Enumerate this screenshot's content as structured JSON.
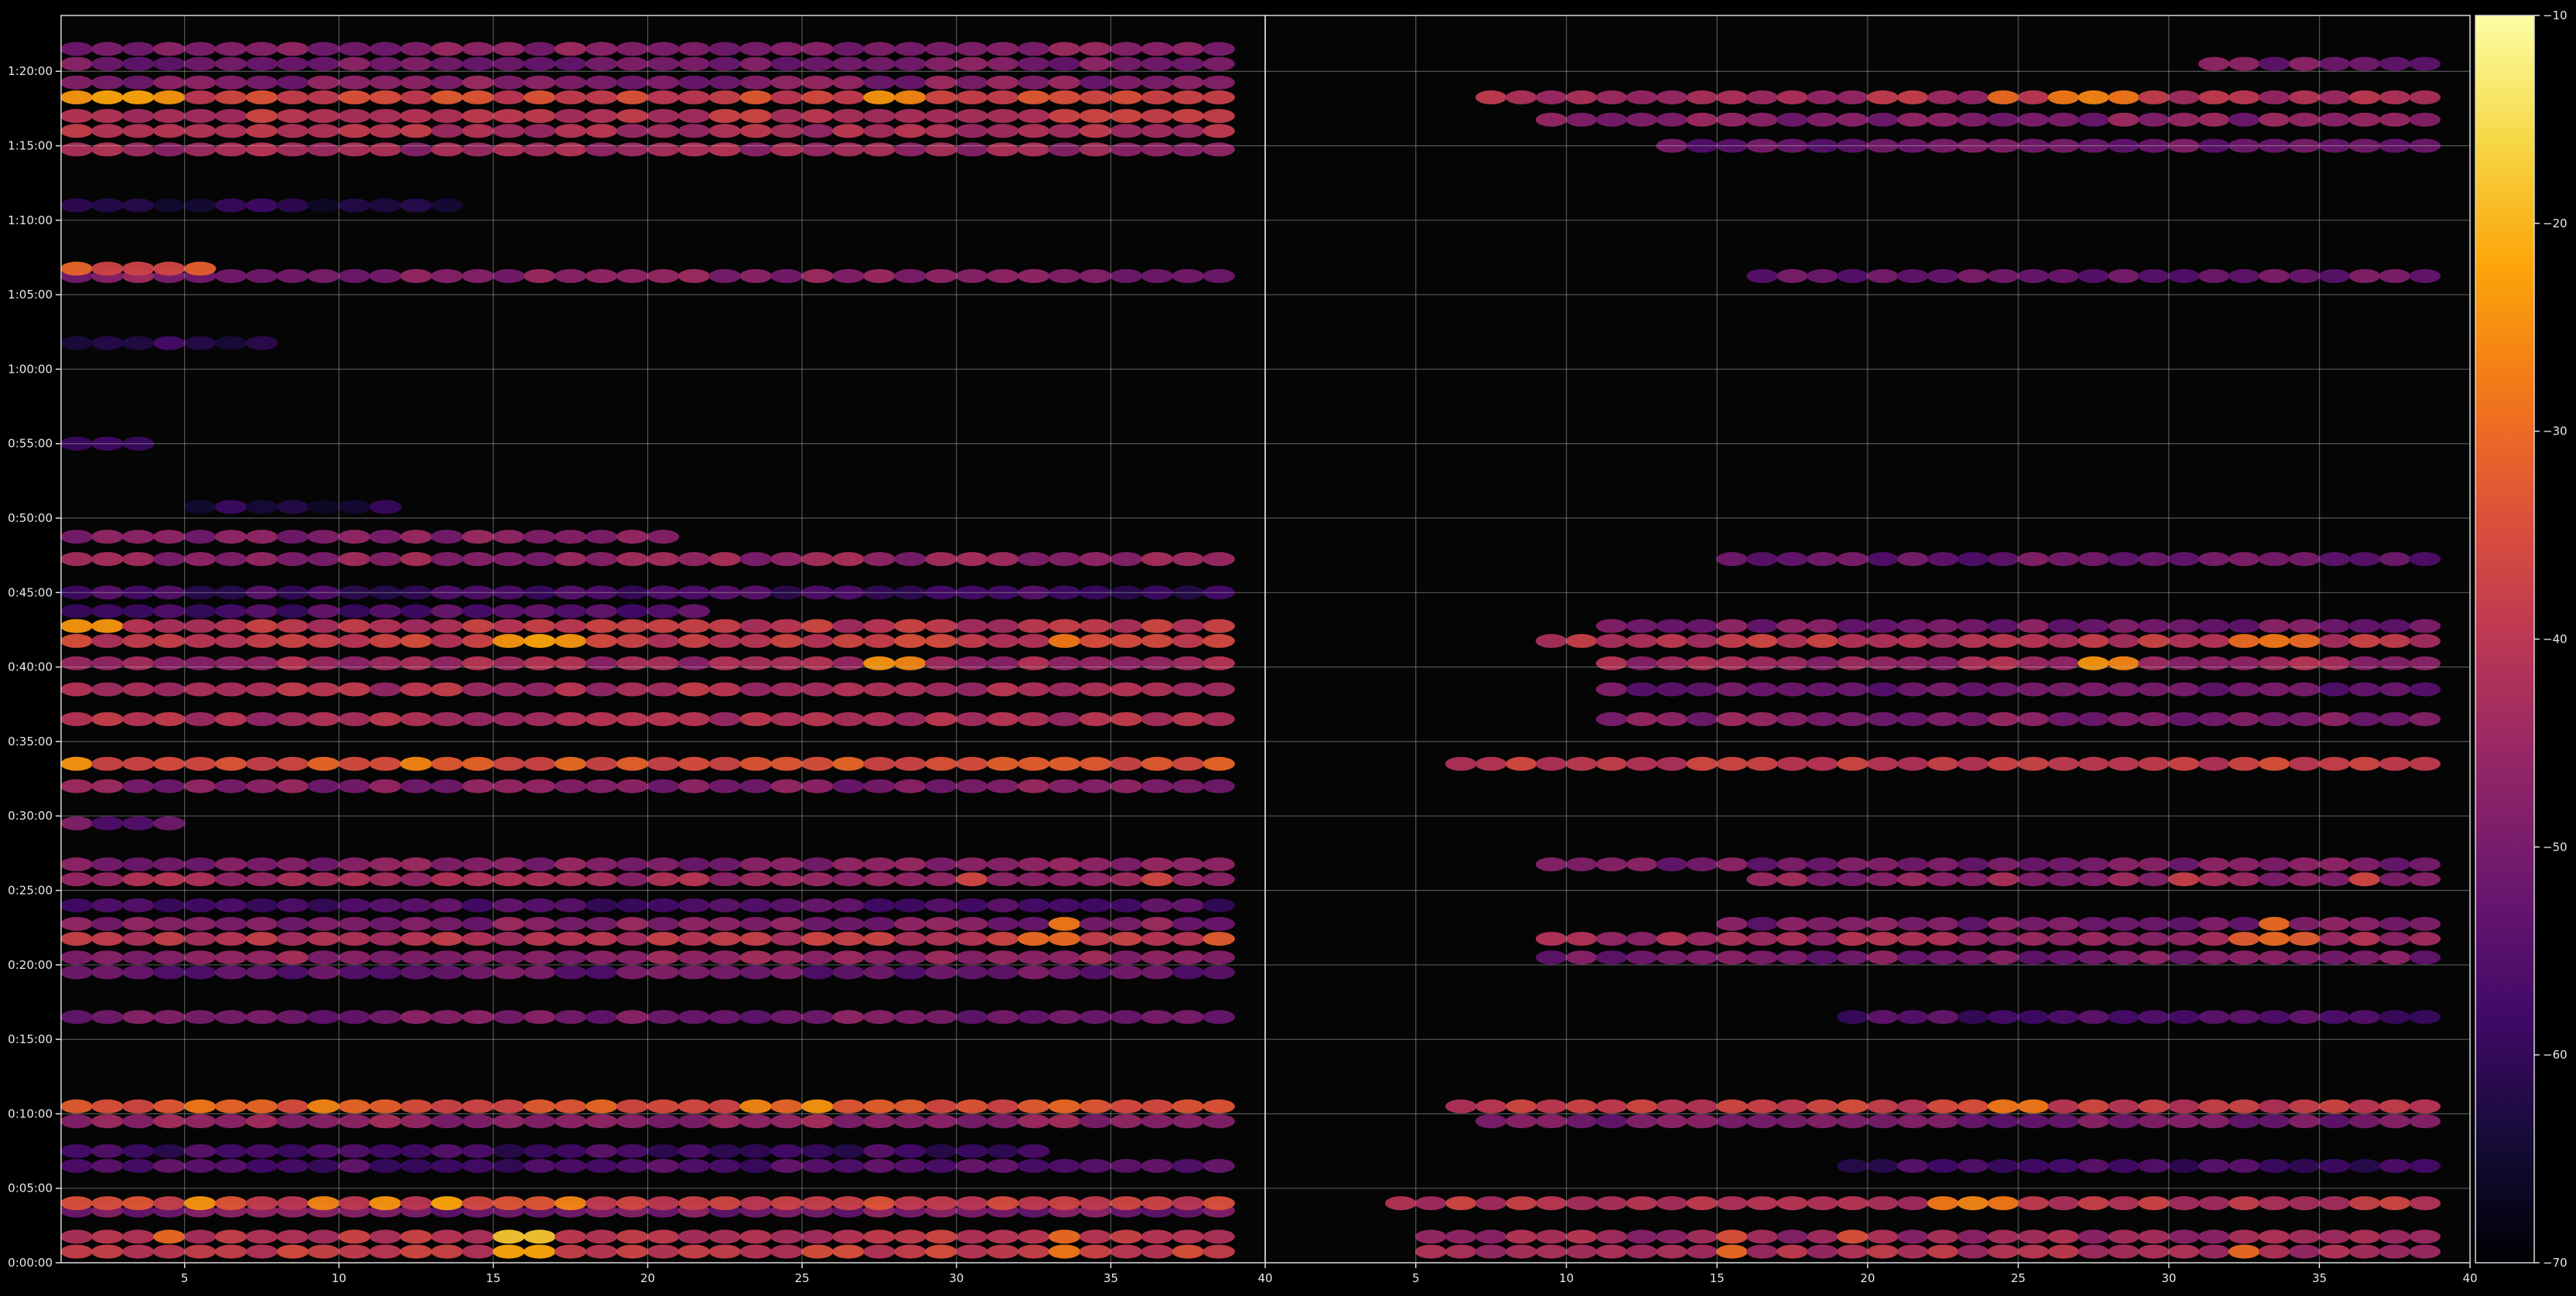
{
  "chart_data": {
    "type": "heatmap",
    "title": "",
    "colormap": "inferno",
    "colorbar": {
      "range": [
        -70,
        -10
      ],
      "ticks": [
        -10,
        -20,
        -30,
        -40,
        -50,
        -60,
        -70
      ]
    },
    "panels": [
      {
        "id": "left",
        "x_range": [
          2,
          40
        ],
        "x_ticks": [
          5,
          10,
          15,
          20,
          25,
          30,
          35,
          40
        ],
        "rows": [
          {
            "t": "0:00:45",
            "base": -38,
            "hot": [
              [
                16,
                -22
              ],
              [
                17,
                -22
              ],
              [
                34,
                -28
              ]
            ]
          },
          {
            "t": "0:01:45",
            "base": -40,
            "hot": [
              [
                5,
                -30
              ],
              [
                16,
                -18
              ],
              [
                17,
                -18
              ],
              [
                34,
                -30
              ]
            ]
          },
          {
            "t": "0:03:30",
            "base": -50,
            "from": 2,
            "to": 39
          },
          {
            "t": "0:04:00",
            "base": -36,
            "hot": [
              [
                6,
                -24
              ],
              [
                10,
                -26
              ],
              [
                12,
                -24
              ],
              [
                14,
                -22
              ],
              [
                18,
                -26
              ]
            ]
          },
          {
            "t": "0:06:30",
            "base": -56,
            "from": 2,
            "to": 39
          },
          {
            "t": "0:07:30",
            "base": -58,
            "from": 2,
            "to": 33
          },
          {
            "t": "0:09:30",
            "base": -46,
            "from": 2,
            "to": 39
          },
          {
            "t": "0:10:30",
            "base": -34,
            "hot": [
              [
                6,
                -28
              ],
              [
                10,
                -26
              ],
              [
                24,
                -26
              ],
              [
                26,
                -24
              ]
            ]
          },
          {
            "t": "0:16:30",
            "base": -50,
            "from": 2,
            "to": 39
          },
          {
            "t": "0:19:30",
            "base": -52,
            "from": 2,
            "to": 39
          },
          {
            "t": "0:20:30",
            "base": -46,
            "from": 2,
            "to": 39
          },
          {
            "t": "0:21:45",
            "base": -40,
            "hot": [
              [
                33,
                -30
              ],
              [
                34,
                -30
              ],
              [
                39,
                -32
              ]
            ]
          },
          {
            "t": "0:22:45",
            "base": -48,
            "hot": [
              [
                34,
                -28
              ]
            ]
          },
          {
            "t": "0:24:00",
            "base": -56,
            "from": 2,
            "to": 39
          },
          {
            "t": "0:25:45",
            "base": -44,
            "hot": [
              [
                31,
                -36
              ],
              [
                37,
                -36
              ]
            ]
          },
          {
            "t": "0:26:45",
            "base": -48,
            "from": 2,
            "to": 39
          },
          {
            "t": "0:29:30",
            "base": -52,
            "from": 2,
            "to": 5
          },
          {
            "t": "0:32:00",
            "base": -48,
            "from": 2,
            "to": 39
          },
          {
            "t": "0:33:30",
            "base": -34,
            "hot": [
              [
                2,
                -24
              ],
              [
                13,
                -26
              ]
            ]
          },
          {
            "t": "0:36:30",
            "base": -42,
            "from": 2,
            "to": 39
          },
          {
            "t": "0:38:30",
            "base": -42,
            "from": 2,
            "to": 39
          },
          {
            "t": "0:40:15",
            "base": -44,
            "hot": [
              [
                28,
                -24
              ],
              [
                29,
                -26
              ]
            ]
          },
          {
            "t": "0:41:45",
            "base": -38,
            "hot": [
              [
                16,
                -24
              ],
              [
                17,
                -22
              ],
              [
                18,
                -24
              ],
              [
                34,
                -28
              ]
            ]
          },
          {
            "t": "0:42:45",
            "base": -40,
            "hot": [
              [
                2,
                -24
              ],
              [
                3,
                -24
              ]
            ]
          },
          {
            "t": "0:43:45",
            "base": -56,
            "from": 2,
            "to": 22
          },
          {
            "t": "0:45:00",
            "base": -58,
            "from": 2,
            "to": 39
          },
          {
            "t": "0:47:15",
            "base": -46,
            "from": 2,
            "to": 39
          },
          {
            "t": "0:48:45",
            "base": -48,
            "from": 2,
            "to": 21
          },
          {
            "t": "0:50:45",
            "base": -62,
            "from": 6,
            "to": 12
          },
          {
            "t": "0:55:00",
            "base": -60,
            "from": 2,
            "to": 4
          },
          {
            "t": "1:01:45",
            "base": -60,
            "from": 2,
            "to": 8
          },
          {
            "t": "1:06:15",
            "base": -48,
            "from": 2,
            "to": 39
          },
          {
            "t": "1:06:45",
            "base": -34,
            "from": 2,
            "to": 6
          },
          {
            "t": "1:11:00",
            "base": -62,
            "from": 2,
            "to": 14
          },
          {
            "t": "1:14:45",
            "base": -44,
            "from": 2,
            "to": 39
          },
          {
            "t": "1:16:00",
            "base": -42,
            "from": 2,
            "to": 39
          },
          {
            "t": "1:17:00",
            "base": -40,
            "from": 2,
            "to": 39
          },
          {
            "t": "1:18:15",
            "base": -36,
            "hot": [
              [
                2,
                -24
              ],
              [
                3,
                -22
              ],
              [
                4,
                -22
              ],
              [
                5,
                -24
              ],
              [
                28,
                -24
              ],
              [
                29,
                -26
              ]
            ]
          },
          {
            "t": "1:19:15",
            "base": -48,
            "from": 2,
            "to": 39
          },
          {
            "t": "1:20:30",
            "base": -50,
            "from": 2,
            "to": 39
          },
          {
            "t": "1:21:30",
            "base": -48,
            "from": 2,
            "to": 39
          }
        ]
      },
      {
        "id": "right",
        "x_range": [
          1,
          40
        ],
        "x_ticks": [
          5,
          10,
          15,
          20,
          25,
          30,
          35,
          40
        ],
        "rows": [
          {
            "t": "0:00:45",
            "base": -42,
            "from": 6,
            "to": 39,
            "hot": [
              [
                16,
                -30
              ],
              [
                33,
                -30
              ]
            ]
          },
          {
            "t": "0:01:45",
            "base": -44,
            "from": 6,
            "to": 39,
            "hot": [
              [
                16,
                -34
              ],
              [
                20,
                -34
              ]
            ]
          },
          {
            "t": "0:04:00",
            "base": -40,
            "from": 5,
            "to": 39,
            "hot": [
              [
                23,
                -28
              ],
              [
                24,
                -26
              ],
              [
                25,
                -28
              ]
            ]
          },
          {
            "t": "0:06:30",
            "base": -58,
            "from": 20,
            "to": 39
          },
          {
            "t": "0:09:30",
            "base": -50,
            "from": 8,
            "to": 39
          },
          {
            "t": "0:10:30",
            "base": -38,
            "from": 7,
            "to": 39,
            "hot": [
              [
                25,
                -28
              ],
              [
                26,
                -28
              ]
            ]
          },
          {
            "t": "0:16:30",
            "base": -56,
            "from": 20,
            "to": 39
          },
          {
            "t": "0:20:30",
            "base": -50,
            "from": 10,
            "to": 39
          },
          {
            "t": "0:21:45",
            "base": -44,
            "from": 10,
            "to": 39,
            "hot": [
              [
                33,
                -32
              ],
              [
                34,
                -30
              ],
              [
                35,
                -32
              ]
            ]
          },
          {
            "t": "0:22:45",
            "base": -50,
            "from": 16,
            "to": 39,
            "hot": [
              [
                34,
                -30
              ]
            ]
          },
          {
            "t": "0:25:45",
            "base": -46,
            "from": 17,
            "to": 39,
            "hot": [
              [
                31,
                -38
              ],
              [
                37,
                -36
              ]
            ]
          },
          {
            "t": "0:26:45",
            "base": -50,
            "from": 10,
            "to": 39
          },
          {
            "t": "0:33:30",
            "base": -38,
            "from": 7,
            "to": 39
          },
          {
            "t": "0:36:30",
            "base": -48,
            "from": 12,
            "to": 39
          },
          {
            "t": "0:38:30",
            "base": -52,
            "from": 12,
            "to": 39
          },
          {
            "t": "0:40:15",
            "base": -44,
            "from": 12,
            "to": 39,
            "hot": [
              [
                28,
                -24
              ],
              [
                29,
                -26
              ]
            ]
          },
          {
            "t": "0:41:45",
            "base": -40,
            "from": 10,
            "to": 39,
            "hot": [
              [
                33,
                -30
              ],
              [
                34,
                -28
              ],
              [
                35,
                -30
              ]
            ]
          },
          {
            "t": "0:42:45",
            "base": -50,
            "from": 12,
            "to": 39
          },
          {
            "t": "0:47:15",
            "base": -52,
            "from": 16,
            "to": 39
          },
          {
            "t": "1:06:15",
            "base": -52,
            "from": 17,
            "to": 39
          },
          {
            "t": "1:15:00",
            "base": -52,
            "from": 14,
            "to": 39
          },
          {
            "t": "1:16:45",
            "base": -48,
            "from": 10,
            "to": 39
          },
          {
            "t": "1:18:15",
            "base": -42,
            "from": 8,
            "to": 39,
            "hot": [
              [
                25,
                -30
              ],
              [
                27,
                -28
              ],
              [
                28,
                -26
              ],
              [
                29,
                -28
              ]
            ]
          },
          {
            "t": "1:20:30",
            "base": -50,
            "from": 32,
            "to": 39
          }
        ]
      }
    ],
    "y_ticks": [
      "0:00:00",
      "0:05:00",
      "0:10:00",
      "0:15:00",
      "0:20:00",
      "0:25:00",
      "0:30:00",
      "0:35:00",
      "0:40:00",
      "0:45:00",
      "0:50:00",
      "0:55:00",
      "1:00:00",
      "1:05:00",
      "1:10:00",
      "1:15:00",
      "1:20:00"
    ],
    "y_range_seconds": [
      0,
      5025
    ],
    "grid": true
  }
}
